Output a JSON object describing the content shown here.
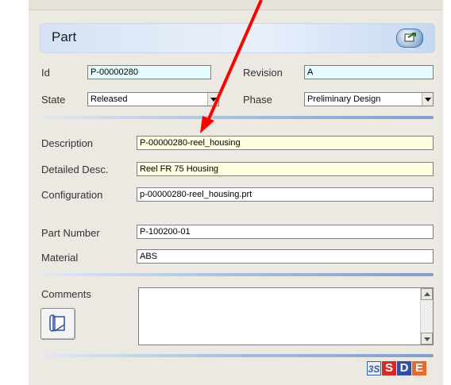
{
  "panel": {
    "title": "Part"
  },
  "fields": {
    "id": {
      "label": "Id",
      "value": "P-00000280"
    },
    "revision": {
      "label": "Revision",
      "value": "A"
    },
    "state": {
      "label": "State",
      "value": "Released"
    },
    "phase": {
      "label": "Phase",
      "value": "Preliminary Design"
    },
    "description": {
      "label": "Description",
      "value": "P-00000280-reel_housing"
    },
    "detailed_desc": {
      "label": "Detailed Desc.",
      "value": "Reel FR 75 Housing"
    },
    "configuration": {
      "label": "Configuration",
      "value": "p-00000280-reel_housing.prt"
    },
    "part_number": {
      "label": "Part Number",
      "value": "P-100200-01"
    },
    "material": {
      "label": "Material",
      "value": "ABS"
    },
    "comments": {
      "label": "Comments",
      "value": ""
    }
  },
  "logo": {
    "letters": [
      "",
      "S",
      "D",
      "E"
    ]
  },
  "colors": {
    "annotation_arrow": "#ff0000",
    "header_gradient": "#d6e2f2",
    "cyan_field": "#e6fbff",
    "yellow_field": "#fffde0"
  },
  "icons": {
    "header_button": "export-icon",
    "attach_button": "attachment-icon",
    "logo_mark": "3ds-logo-icon"
  }
}
